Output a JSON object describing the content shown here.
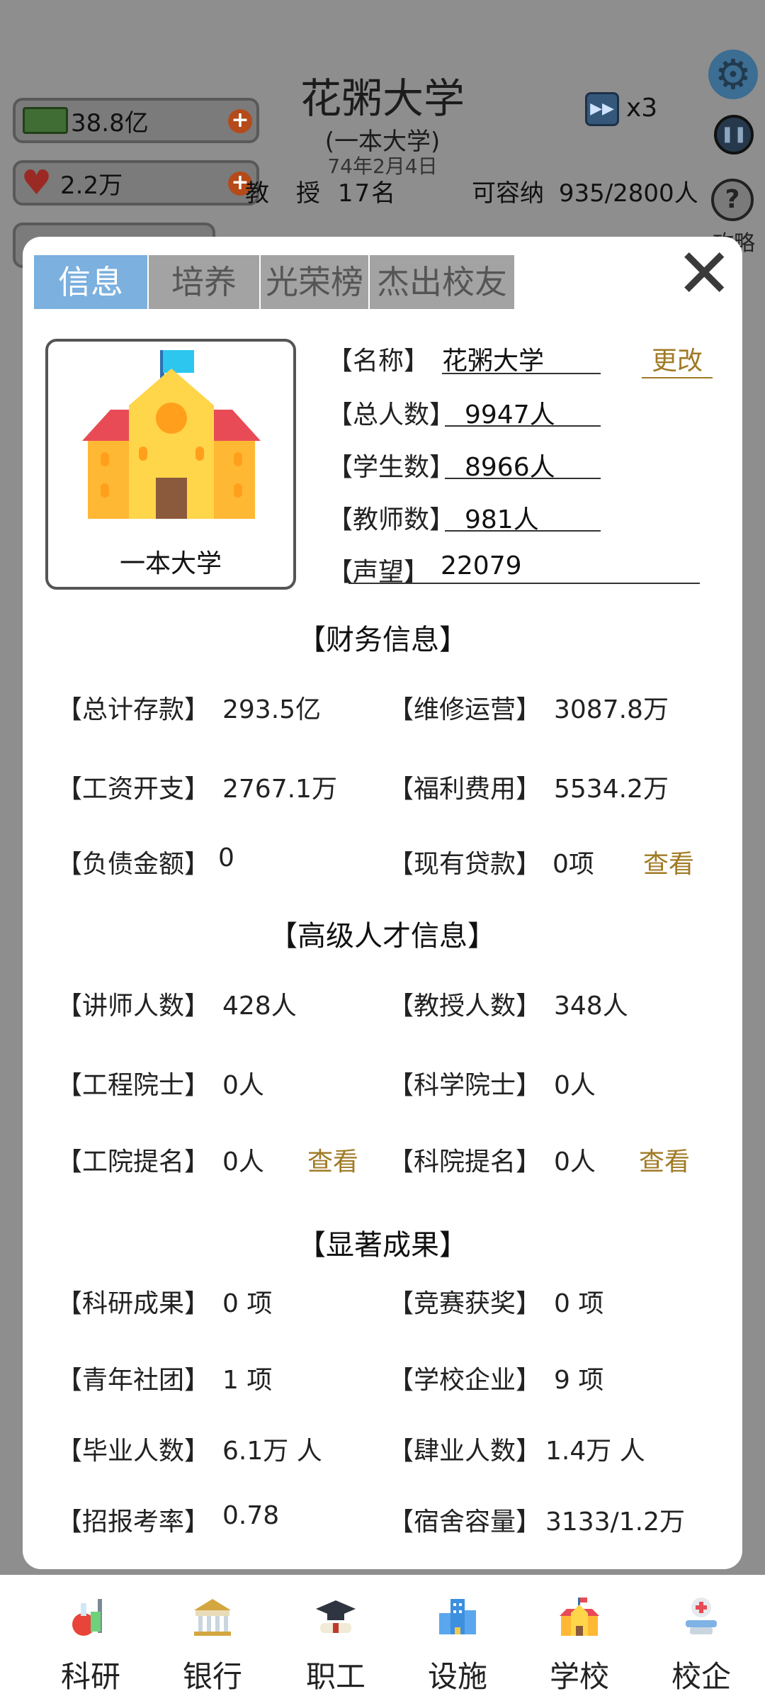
{
  "hud": {
    "university_name": "花粥大学",
    "university_tier": "(一本大学)",
    "date": "74年2月4日",
    "money": "38.8亿",
    "reputation_fans": "2.2万",
    "speed_label": "x3",
    "professors_text_prefix": "教　授",
    "professors_count": "17名",
    "capacity_label": "可容纳",
    "capacity_value": "935/2800人",
    "guide_label": "攻略"
  },
  "tabs": [
    "信息",
    "培养",
    "光荣榜",
    "杰出校友"
  ],
  "active_tab": "信息",
  "school": {
    "tier_label": "一本大学",
    "name_label": "【名称】",
    "name_value": "花粥大学",
    "edit_label": "更改",
    "total_label": "【总人数】",
    "total_value": "9947人",
    "students_label": "【学生数】",
    "students_value": "8966人",
    "teachers_label": "【教师数】",
    "teachers_value": "981人",
    "prestige_label": "【声望】",
    "prestige_value": "22079"
  },
  "finance": {
    "title": "【财务信息】",
    "items": [
      {
        "label": "【总计存款】",
        "value": "293.5亿"
      },
      {
        "label": "【维修运营】",
        "value": "3087.8万"
      },
      {
        "label": "【工资开支】",
        "value": "2767.1万"
      },
      {
        "label": "【福利费用】",
        "value": "5534.2万"
      },
      {
        "label": "【负债金额】",
        "value": "0"
      },
      {
        "label": "【现有贷款】",
        "value": "0项",
        "link": "查看"
      }
    ]
  },
  "talent": {
    "title": "【高级人才信息】",
    "items": [
      {
        "label": "【讲师人数】",
        "value": "428人"
      },
      {
        "label": "【教授人数】",
        "value": "348人"
      },
      {
        "label": "【工程院士】",
        "value": "0人"
      },
      {
        "label": "【科学院士】",
        "value": "0人"
      },
      {
        "label": "【工院提名】",
        "value": "0人",
        "link": "查看"
      },
      {
        "label": "【科院提名】",
        "value": "0人",
        "link": "查看"
      }
    ]
  },
  "achievements": {
    "title": "【显著成果】",
    "items": [
      {
        "label": "【科研成果】",
        "value": "0 项"
      },
      {
        "label": "【竞赛获奖】",
        "value": "0 项"
      },
      {
        "label": "【青年社团】",
        "value": "1 项"
      },
      {
        "label": "【学校企业】",
        "value": "9 项"
      },
      {
        "label": "【毕业人数】",
        "value": "6.1万 人"
      },
      {
        "label": "【肆业人数】",
        "value": "1.4万 人"
      },
      {
        "label": "【招报考率】",
        "value": "0.78"
      },
      {
        "label": "【宿舍容量】",
        "value": "3133/1.2万"
      }
    ]
  },
  "bottom_nav": [
    {
      "label": "科研",
      "icon": "lab-flask-icon"
    },
    {
      "label": "银行",
      "icon": "bank-icon"
    },
    {
      "label": "职工",
      "icon": "graduation-cap-icon"
    },
    {
      "label": "设施",
      "icon": "buildings-icon"
    },
    {
      "label": "学校",
      "icon": "school-icon"
    },
    {
      "label": "校企",
      "icon": "medical-icon"
    }
  ],
  "colors": {
    "tab_active": "#7bb0df",
    "tab_inactive": "#a3a3a3",
    "link": "#a07a24",
    "overlay": "#8e8e8e"
  }
}
